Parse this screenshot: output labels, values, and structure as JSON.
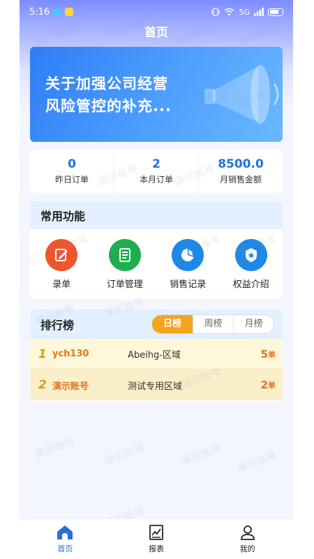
{
  "status_bar": {
    "time": "5:16",
    "network": "5G"
  },
  "header": {
    "title": "首页"
  },
  "banner": {
    "line1": "关于加强公司经营",
    "line2": "风险管控的补充..."
  },
  "stats": [
    {
      "value": "0",
      "label": "昨日订单"
    },
    {
      "value": "2",
      "label": "本月订单"
    },
    {
      "value": "8500.0",
      "label": "月销售金额"
    }
  ],
  "functions": {
    "title": "常用功能",
    "items": [
      {
        "label": "录单",
        "icon": "edit-icon",
        "color": "#f0532e"
      },
      {
        "label": "订单管理",
        "icon": "document-icon",
        "color": "#1fae4d"
      },
      {
        "label": "销售记录",
        "icon": "pie-chart-icon",
        "color": "#1e88e5"
      },
      {
        "label": "权益介绍",
        "icon": "badge-icon",
        "color": "#1e88e5"
      }
    ]
  },
  "ranking": {
    "title": "排行榜",
    "tabs": [
      "日榜",
      "周榜",
      "月榜"
    ],
    "active_tab": "日榜",
    "rows": [
      {
        "rank": "1",
        "name": "ych130",
        "area": "Abeihg-区域",
        "count": "5",
        "unit": "单"
      },
      {
        "rank": "2",
        "name": "演示账号",
        "area": "测试专用区域",
        "count": "2",
        "unit": "单"
      }
    ]
  },
  "tabbar": {
    "items": [
      {
        "label": "首页",
        "icon": "home-icon",
        "active": true
      },
      {
        "label": "报表",
        "icon": "report-icon",
        "active": false
      },
      {
        "label": "我的",
        "icon": "user-icon",
        "active": false
      }
    ]
  },
  "watermark": {
    "text": "演示账号"
  },
  "colors": {
    "accent": "#f5a51c",
    "brand_blue": "#1f73d8"
  }
}
